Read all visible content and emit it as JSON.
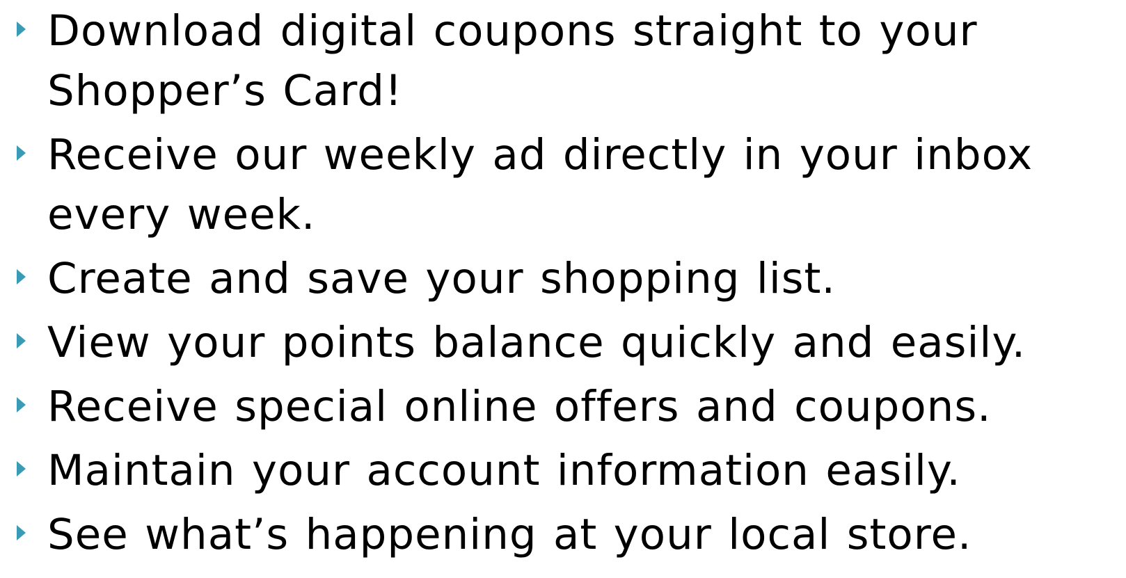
{
  "colors": {
    "bullet": "#3a9bb6",
    "text": "#000000",
    "background": "#ffffff"
  },
  "bullet_icon": "triangle-right-icon",
  "items": [
    {
      "text": "Download digital coupons straight to your Shopper’s Card!"
    },
    {
      "text": "Receive our weekly ad directly in your inbox every week."
    },
    {
      "text": "Create and save your shopping list."
    },
    {
      "text": "View your points balance quickly and easily."
    },
    {
      "text": "Receive special online offers and coupons."
    },
    {
      "text": "Maintain your account information easily."
    },
    {
      "text": "See what’s happening at your local store."
    }
  ]
}
